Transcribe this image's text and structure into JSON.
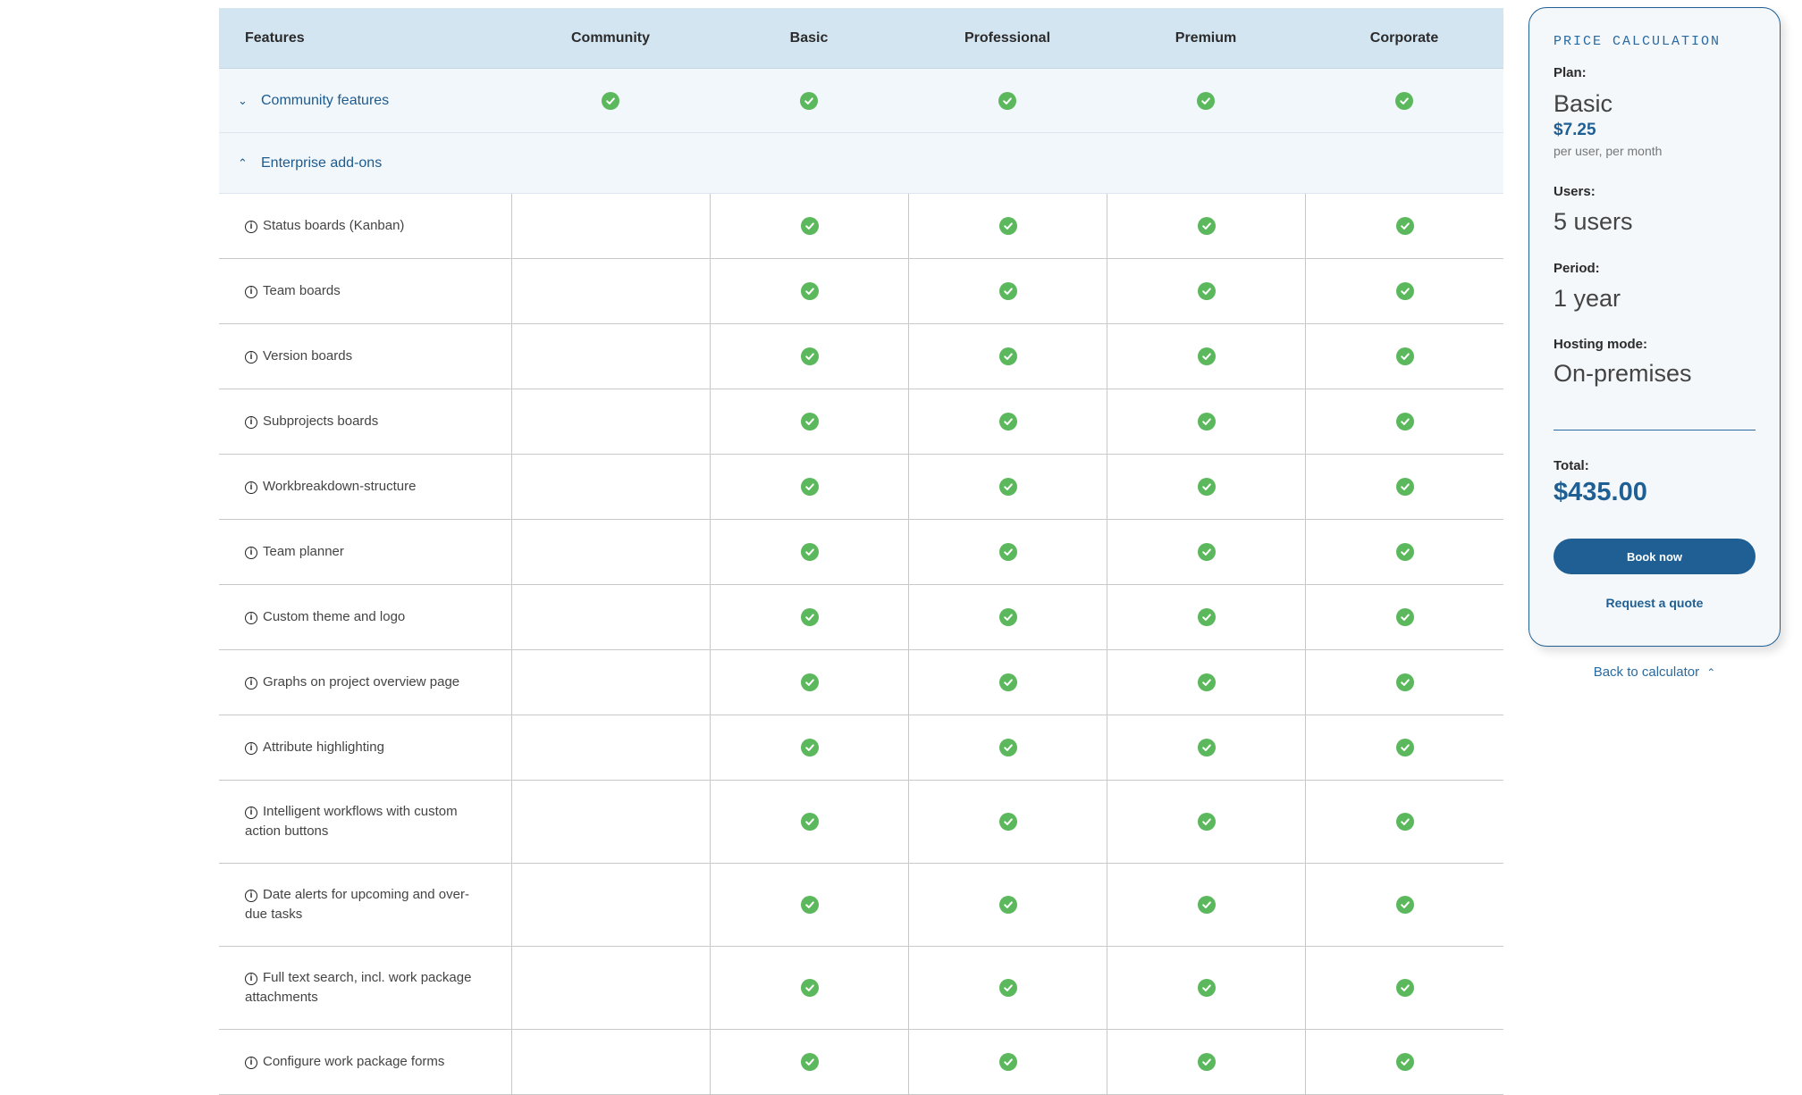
{
  "table": {
    "header": {
      "features": "Features",
      "plans": [
        "Community",
        "Basic",
        "Professional",
        "Premium",
        "Corporate"
      ]
    },
    "groups": {
      "community": {
        "label": "Community features",
        "chevron": "chevron-down",
        "included": [
          true,
          true,
          true,
          true,
          true
        ]
      },
      "enterprise": {
        "label": "Enterprise add-ons",
        "chevron": "chevron-up"
      }
    },
    "rows": [
      {
        "label": "Status boards (Kanban)",
        "included": [
          false,
          true,
          true,
          true,
          true
        ]
      },
      {
        "label": "Team boards",
        "included": [
          false,
          true,
          true,
          true,
          true
        ]
      },
      {
        "label": "Version boards",
        "included": [
          false,
          true,
          true,
          true,
          true
        ]
      },
      {
        "label": "Subprojects boards",
        "included": [
          false,
          true,
          true,
          true,
          true
        ]
      },
      {
        "label": "Workbreakdown-structure",
        "included": [
          false,
          true,
          true,
          true,
          true
        ]
      },
      {
        "label": "Team planner",
        "included": [
          false,
          true,
          true,
          true,
          true
        ]
      },
      {
        "label": "Custom theme and logo",
        "included": [
          false,
          true,
          true,
          true,
          true
        ]
      },
      {
        "label": "Graphs on project overview page",
        "included": [
          false,
          true,
          true,
          true,
          true
        ]
      },
      {
        "label": "Attribute highlighting",
        "included": [
          false,
          true,
          true,
          true,
          true
        ]
      },
      {
        "label": "Intelligent workflows with custom action buttons",
        "included": [
          false,
          true,
          true,
          true,
          true
        ]
      },
      {
        "label": "Date alerts for upcoming and over-due tasks",
        "included": [
          false,
          true,
          true,
          true,
          true
        ]
      },
      {
        "label": "Full text search, incl. work package attachments",
        "included": [
          false,
          true,
          true,
          true,
          true
        ]
      },
      {
        "label": "Configure work package forms",
        "included": [
          false,
          true,
          true,
          true,
          true
        ]
      }
    ]
  },
  "panel": {
    "title": "PRICE CALCULATION",
    "plan_label": "Plan:",
    "plan_value": "Basic",
    "plan_price": "$7.25",
    "plan_price_note": "per user, per month",
    "users_label": "Users:",
    "users_value": "5 users",
    "period_label": "Period:",
    "period_value": "1 year",
    "hosting_label": "Hosting mode:",
    "hosting_value": "On-premises",
    "total_label": "Total:",
    "total_value": "$435.00",
    "book_button": "Book now",
    "quote_link": "Request a quote"
  },
  "back_link": "Back to calculator",
  "colors": {
    "accent": "#1f5f94",
    "header_bg": "#d4e5f2",
    "check": "#5cb85c"
  }
}
